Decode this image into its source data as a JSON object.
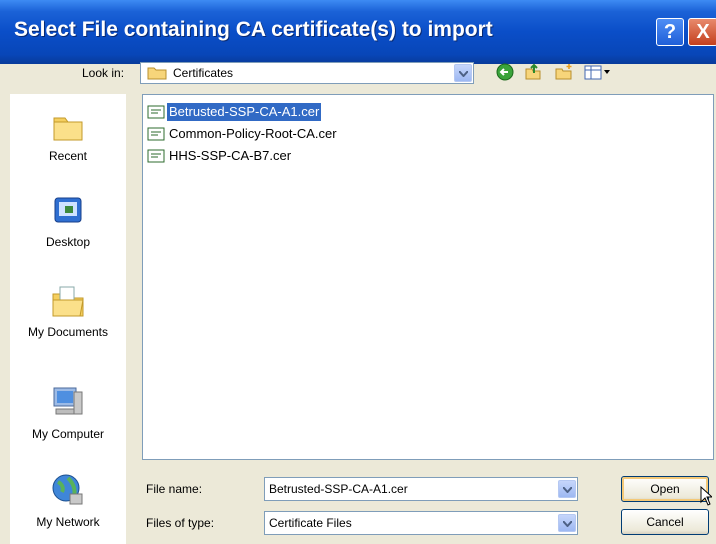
{
  "window": {
    "title": "Select File containing CA certificate(s) to import"
  },
  "titlebar": {
    "help_label": "?",
    "close_label": "X"
  },
  "toolbar": {
    "look_in_label": "Look in:",
    "look_in_value": "Certificates",
    "icons": [
      "back-icon",
      "up-folder-icon",
      "new-folder-icon",
      "views-menu-icon"
    ]
  },
  "places": [
    {
      "label": "Recent",
      "icon": "recent-icon"
    },
    {
      "label": "Desktop",
      "icon": "desktop-icon"
    },
    {
      "label": "My Documents",
      "icon": "my-documents-icon"
    },
    {
      "label": "My Computer",
      "icon": "my-computer-icon"
    },
    {
      "label": "My Network",
      "icon": "my-network-icon"
    }
  ],
  "files": [
    {
      "name": "Betrusted-SSP-CA-A1.cer",
      "selected": true
    },
    {
      "name": "Common-Policy-Root-CA.cer",
      "selected": false
    },
    {
      "name": "HHS-SSP-CA-B7.cer",
      "selected": false
    }
  ],
  "file_name": {
    "label": "File name:",
    "value": "Betrusted-SSP-CA-A1.cer"
  },
  "file_type": {
    "label": "Files of type:",
    "value": "Certificate Files"
  },
  "buttons": {
    "open": "Open",
    "cancel": "Cancel"
  },
  "colors": {
    "selection": "#316ac5",
    "titlebar": "#0a4ec8",
    "dialog_bg": "#ece9d8"
  }
}
